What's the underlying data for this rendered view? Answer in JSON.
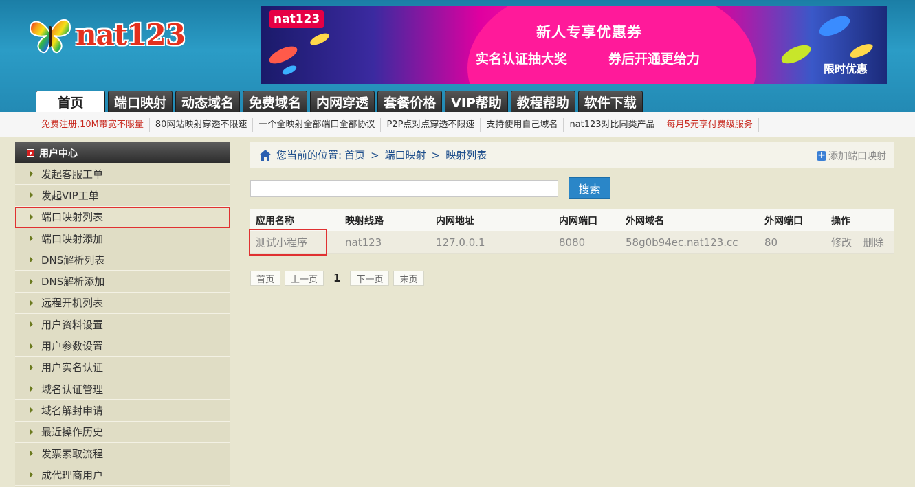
{
  "logo": {
    "text": "nat123"
  },
  "banner": {
    "brand": "nat123",
    "title": "新人专享优惠券",
    "subtitle_left": "实名认证抽大奖",
    "subtitle_right": "券后开通更给力",
    "badge": "限时优惠"
  },
  "nav": {
    "tabs": [
      {
        "label": "首页",
        "active": true
      },
      {
        "label": "端口映射"
      },
      {
        "label": "动态域名"
      },
      {
        "label": "免费域名"
      },
      {
        "label": "内网穿透"
      },
      {
        "label": "套餐价格"
      },
      {
        "label": "VIP帮助"
      },
      {
        "label": "教程帮助"
      },
      {
        "label": "软件下载"
      }
    ]
  },
  "promo": {
    "items": [
      {
        "label": "免费注册,10M带宽不限量",
        "red": true
      },
      {
        "label": "80网站映射穿透不限速"
      },
      {
        "label": "一个全映射全部端口全部协议"
      },
      {
        "label": "P2P点对点穿透不限速"
      },
      {
        "label": "支持使用自己域名"
      },
      {
        "label": "nat123对比同类产品"
      },
      {
        "label": "每月5元享付费级服务",
        "red": true
      }
    ]
  },
  "sidebar": {
    "title": "用户中心",
    "items": [
      {
        "label": "发起客服工单"
      },
      {
        "label": "发起VIP工单"
      },
      {
        "label": "端口映射列表",
        "highlight": true
      },
      {
        "label": "端口映射添加"
      },
      {
        "label": "DNS解析列表"
      },
      {
        "label": "DNS解析添加"
      },
      {
        "label": "远程开机列表"
      },
      {
        "label": "用户资料设置"
      },
      {
        "label": "用户参数设置"
      },
      {
        "label": "用户实名认证"
      },
      {
        "label": "域名认证管理"
      },
      {
        "label": "域名解封申请"
      },
      {
        "label": "最近操作历史"
      },
      {
        "label": "发票索取流程"
      },
      {
        "label": "成代理商用户"
      }
    ]
  },
  "breadcrumb": {
    "prefix": "您当前的位置:",
    "items": [
      "首页",
      "端口映射",
      "映射列表"
    ],
    "separator": ">",
    "add_label": "添加端口映射"
  },
  "search": {
    "value": "",
    "placeholder": "",
    "button_label": "搜索"
  },
  "table": {
    "headers": [
      "应用名称",
      "映射线路",
      "内网地址",
      "内网端口",
      "外网域名",
      "外网端口",
      "操作"
    ],
    "rows": [
      {
        "app_name": "测试小程序",
        "line": "nat123",
        "internal_addr": "127.0.0.1",
        "internal_port": "8080",
        "external_domain": "58g0b94ec.nat123.cc",
        "external_port": "80",
        "edit": "修改",
        "delete": "删除"
      }
    ]
  },
  "pager": {
    "first": "首页",
    "prev": "上一页",
    "current": "1",
    "next": "下一页",
    "last": "末页"
  },
  "colors": {
    "header_blue": "#2b9cc6",
    "highlight_red": "#e03131",
    "search_button": "#2a86c8",
    "promo_red": "#c8281e"
  }
}
